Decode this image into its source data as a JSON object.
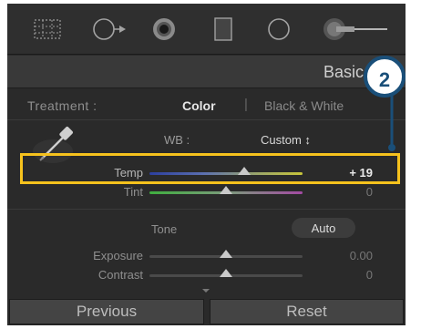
{
  "panel": {
    "title": "Basic"
  },
  "treatment": {
    "label": "Treatment :",
    "color": "Color",
    "separator": "|",
    "bw": "Black & White"
  },
  "wb": {
    "label": "WB :",
    "value": "Custom ↕"
  },
  "sliders": {
    "temp": {
      "label": "Temp",
      "value": "+ 19",
      "level": 0.62
    },
    "tint": {
      "label": "Tint",
      "value": "0",
      "level": 0.5
    },
    "exposure": {
      "label": "Exposure",
      "value": "0.00",
      "level": 0.5
    },
    "contrast": {
      "label": "Contrast",
      "value": "0",
      "level": 0.5
    }
  },
  "tone": {
    "label": "Tone",
    "auto": "Auto"
  },
  "buttons": {
    "previous": "Previous",
    "reset": "Reset"
  },
  "callout": {
    "number": "2"
  },
  "colors": {
    "highlight": "#f6c21d",
    "badge": "#1a4f79"
  },
  "icons": [
    "crop-overlay-icon",
    "spot-removal-icon",
    "red-eye-icon",
    "graduated-filter-icon",
    "radial-filter-icon",
    "adjustment-brush-icon",
    "eyedropper-icon"
  ]
}
